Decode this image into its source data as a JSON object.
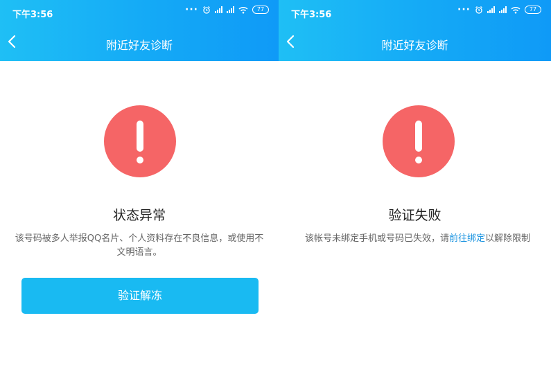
{
  "colors": {
    "header": "#14a9f6",
    "alert": "#f56566",
    "button": "#19baf2",
    "link": "#1a93e0"
  },
  "left": {
    "status": {
      "time": "下午3:56",
      "battery": "77"
    },
    "header": {
      "title": "附近好友诊断",
      "back_icon": "chevron-left-icon"
    },
    "alert_icon": "exclamation-circle-icon",
    "heading": "状态异常",
    "description": "该号码被多人举报QQ名片、个人资料存在不良信息，或使用不文明语言。",
    "button_label": "验证解冻"
  },
  "right": {
    "status": {
      "time": "下午3:56",
      "battery": "77"
    },
    "header": {
      "title": "附近好友诊断",
      "back_icon": "chevron-left-icon"
    },
    "alert_icon": "exclamation-circle-icon",
    "heading": "验证失败",
    "description_prefix": "该帐号未绑定手机或号码已失效，请",
    "description_link": "前往绑定",
    "description_suffix": "以解除限制"
  }
}
